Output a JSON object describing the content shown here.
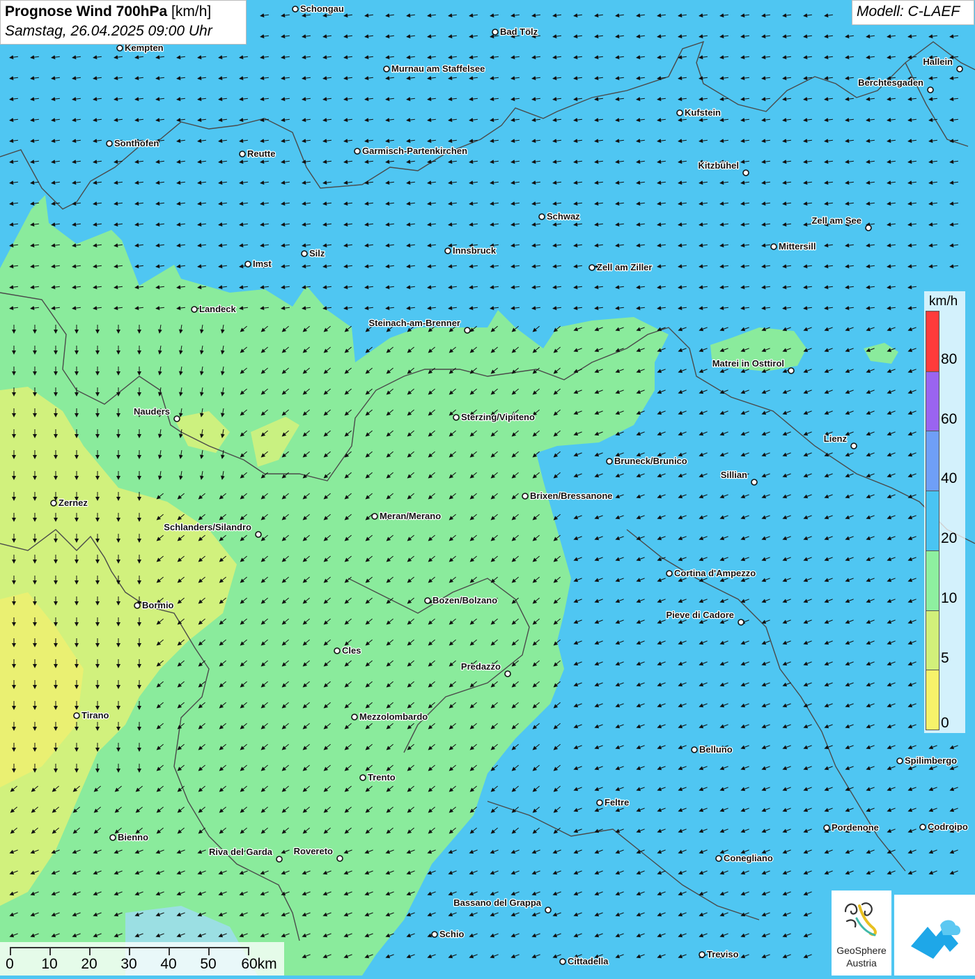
{
  "title": {
    "bold": "Prognose Wind 700hPa",
    "unit": "[km/h]",
    "datetime": "Samstag, 26.04.2025 09:00 Uhr"
  },
  "model": "Modell: C-LAEF",
  "legend": {
    "unit": "km/h",
    "labels": [
      "80",
      "60",
      "40",
      "20",
      "10",
      "5",
      "0"
    ],
    "segments": [
      {
        "color": "#ff3b3b"
      },
      {
        "color": "#9a64f0"
      },
      {
        "color": "#6f9ff7"
      },
      {
        "color": "#49c4f3"
      },
      {
        "color": "#8ef0a0"
      },
      {
        "color": "#d2f07a"
      },
      {
        "color": "#f7f26a"
      }
    ]
  },
  "scale": {
    "labels": [
      "0",
      "10",
      "20",
      "30",
      "40",
      "50",
      "60km"
    ]
  },
  "colors": {
    "blue_field": "#4fc6f2",
    "green_field": "#8aeb9c",
    "yellow_field": "#d8f27a",
    "border_line": "#4a4a4a",
    "arrow": "#111111"
  },
  "cities": [
    "Schongau",
    "Bad Tölz",
    "Kempten",
    "Murnau am Staffelsee",
    "Hallein",
    "Berchtesgaden",
    "Kufstein",
    "Sonthofen",
    "Reutte",
    "Garmisch-Partenkirchen",
    "Kitzbühel",
    "Schwaz",
    "Zell am See",
    "Mittersill",
    "Innsbruck",
    "Silz",
    "Imst",
    "Zell am Ziller",
    "Landeck",
    "Steinach-am-Brenner",
    "Matrei in Osttirol",
    "Nauders",
    "Sterzing/Vipiteno",
    "Lienz",
    "Bruneck/Brunico",
    "Sillian",
    "Brixen/Bressanone",
    "Zernez",
    "Meran/Merano",
    "Schlanders/Silandro",
    "Cortina d'Ampezzo",
    "Bozen/Bolzano",
    "Bormio",
    "Pieve di Cadore",
    "Cles",
    "Predazzo",
    "Tirano",
    "Mezzolombardo",
    "Belluno",
    "Spilimbergo",
    "Trento",
    "Feltre",
    "Pordenone",
    "Codroipo",
    "Bienno",
    "Riva del Garda",
    "Rovereto",
    "Conegliano",
    "Bassano del Grappa",
    "Schio",
    "Treviso",
    "Cittadella"
  ],
  "logos": {
    "geosphere_name": "GeoSphere",
    "geosphere_sub": "Austria"
  }
}
